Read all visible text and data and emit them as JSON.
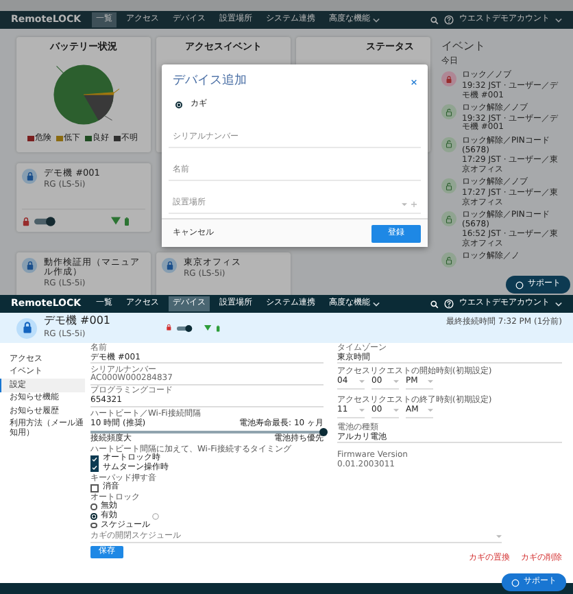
{
  "dashboard": {
    "nav": {
      "logo": "RemoteLOCK",
      "items": [
        {
          "label": "一覧",
          "selected": true,
          "dropdown": false
        },
        {
          "label": "アクセス",
          "selected": false,
          "dropdown": false
        },
        {
          "label": "デバイス",
          "selected": false,
          "dropdown": false
        },
        {
          "label": "設置場所",
          "selected": false,
          "dropdown": false
        },
        {
          "label": "システム連携",
          "selected": false,
          "dropdown": false
        },
        {
          "label": "高度な機能",
          "selected": false,
          "dropdown": true
        }
      ],
      "account": "ウエストデモアカウント"
    },
    "panels": [
      {
        "title": "バッテリー状況"
      },
      {
        "title": "アクセスイベント"
      },
      {
        "title": "ステータス"
      }
    ],
    "legend": [
      {
        "label": "危険",
        "color": "#7a1f1f"
      },
      {
        "label": "低下",
        "color": "#8a6a10"
      },
      {
        "label": "良好",
        "color": "#1f4d22"
      },
      {
        "label": "不明",
        "color": "#303030"
      }
    ],
    "devices": [
      {
        "name": "デモ機 #001",
        "model": "RG (LS-5i)",
        "show_status": true
      },
      {
        "name": "動作検証用（マニュアル作成）",
        "model": "RG (LS-5i)"
      },
      {
        "name": "東京オフィス",
        "model": "RG (LS-5i)"
      }
    ],
    "events": {
      "title": "イベント",
      "day": "今日",
      "items": [
        {
          "kind": "lock",
          "title": "ロック／ノブ",
          "detail": "19:32 JST · ユーザー／デモ機 #001"
        },
        {
          "kind": "unlock",
          "title": "ロック解除／ノブ",
          "detail": "19:32 JST · ユーザー／デモ機 #001"
        },
        {
          "kind": "unlock",
          "title": "ロック解除／PINコード (5678)",
          "detail": "17:29 JST · ユーザー／東京オフィス"
        },
        {
          "kind": "unlock",
          "title": "ロック解除／ノブ",
          "detail": "17:27 JST · ユーザー／東京オフィス"
        },
        {
          "kind": "unlock",
          "title": "ロック解除／PINコード (5678)",
          "detail": "16:52 JST · ユーザー／東京オフィス"
        },
        {
          "kind": "unlock",
          "title": "ロック解除／ノ"
        }
      ]
    },
    "modal": {
      "title": "デバイス追加",
      "options": [
        {
          "label": "カギ",
          "selected": true
        }
      ],
      "fields": [
        {
          "kind": "text",
          "placeholder": "シリアルナンバー"
        },
        {
          "kind": "text",
          "placeholder": "名前"
        },
        {
          "kind": "select",
          "placeholder": "設置場所"
        }
      ],
      "cancel": "キャンセル",
      "submit": "登録"
    },
    "support": "サポート"
  },
  "device_page": {
    "nav": {
      "logo": "RemoteLOCK",
      "items": [
        {
          "label": "一覧",
          "selected": false,
          "dropdown": false
        },
        {
          "label": "アクセス",
          "selected": false,
          "dropdown": false
        },
        {
          "label": "デバイス",
          "selected": true,
          "dropdown": false
        },
        {
          "label": "設置場所",
          "selected": false,
          "dropdown": false
        },
        {
          "label": "システム連携",
          "selected": false,
          "dropdown": false
        },
        {
          "label": "高度な機能",
          "selected": false,
          "dropdown": true
        }
      ],
      "account": "ウエストデモアカウント"
    },
    "header": {
      "name": "デモ機 #001",
      "model": "RG (LS-5i)",
      "last_seen": "最終接続時間 7:32 PM (1分前)"
    },
    "sidebar": [
      {
        "label": "アクセス",
        "selected": false
      },
      {
        "label": "イベント",
        "selected": false
      },
      {
        "label": "設定",
        "selected": true
      },
      {
        "label": "お知らせ機能",
        "selected": false
      },
      {
        "label": "お知らせ履歴",
        "selected": false
      },
      {
        "label": "利用方法（メール通知用）",
        "selected": false
      }
    ],
    "fields": [
      {
        "label": "名前",
        "value": "デモ機 #001",
        "disabled": false
      },
      {
        "label": "シリアルナンバー",
        "value": "AC000W000284837",
        "disabled": true
      },
      {
        "label": "プログラミングコード",
        "value": "654321",
        "disabled": false
      }
    ],
    "heartbeat": {
      "label": "ハートビート／Wi-Fi接続間隔",
      "value_label": "10 時間 (推奨)",
      "battery_label": "電池寿命最長: 10 ヶ月",
      "level": 1,
      "left_hint": "接続頻度大",
      "right_hint": "電池持ち優先"
    },
    "wifi": {
      "label": "ハートビート間隔に加えて、Wi-Fi接続するタイミング",
      "options": [
        {
          "label": "オートロック時",
          "checked": true
        },
        {
          "label": "サムターン操作時",
          "checked": true
        }
      ]
    },
    "keypad": {
      "label": "キーパッド押す音",
      "options": [
        {
          "label": "消音",
          "checked": false
        }
      ]
    },
    "autolock": {
      "label": "オートロック",
      "options": [
        {
          "label": "無効",
          "selected": false
        },
        {
          "label": "有効",
          "selected": true
        },
        {
          "label": "スケジュール",
          "selected": false
        }
      ]
    },
    "schedule": {
      "placeholder": "カギの開閉スケジュール"
    },
    "save": "保存",
    "timezone": {
      "label": "タイムゾーン",
      "value": "東京時間"
    },
    "times": [
      {
        "label": "アクセスリクエストの開始時刻(初期設定)",
        "parts": [
          "04",
          "00",
          "PM"
        ]
      },
      {
        "label": "アクセスリクエストの終了時刻(初期設定)",
        "parts": [
          "11",
          "00",
          "AM"
        ]
      }
    ],
    "battery": {
      "label": "電池の種類",
      "value": "アルカリ電池"
    },
    "firmware": {
      "label": "Firmware Version",
      "value": "0.01.2003011"
    },
    "actions": [
      "カギの置換",
      "カギの削除"
    ],
    "support": "サポート"
  }
}
